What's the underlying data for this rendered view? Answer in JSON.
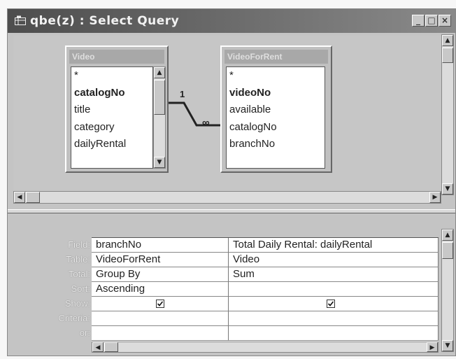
{
  "window": {
    "title": "qbe(z) : Select Query",
    "minimize_icon": "minimize-icon",
    "maximize_icon": "maximize-icon",
    "close_icon": "close-icon"
  },
  "tables": [
    {
      "name": "Video",
      "fields": [
        "*",
        "catalogNo",
        "title",
        "category",
        "dailyRental"
      ],
      "key_field": "catalogNo"
    },
    {
      "name": "VideoForRent",
      "fields": [
        "*",
        "videoNo",
        "available",
        "catalogNo",
        "branchNo"
      ],
      "key_field": "videoNo"
    }
  ],
  "relationship": {
    "one_side": "1",
    "many_side": "∞"
  },
  "grid": {
    "row_labels": [
      "Field:",
      "Table:",
      "Total:",
      "Sort:",
      "Show:",
      "Criteria:",
      "or:"
    ],
    "columns": [
      {
        "field": "branchNo",
        "table": "VideoForRent",
        "total": "Group By",
        "sort": "Ascending",
        "show": true,
        "criteria": "",
        "or": ""
      },
      {
        "field": "Total Daily Rental: dailyRental",
        "table": "Video",
        "total": "Sum",
        "sort": "",
        "show": true,
        "criteria": "",
        "or": ""
      }
    ]
  },
  "colors": {
    "titlebar": "#6a6a6a",
    "grid_bg": "#ffffff",
    "pane_bg": "#c4c4c4"
  }
}
